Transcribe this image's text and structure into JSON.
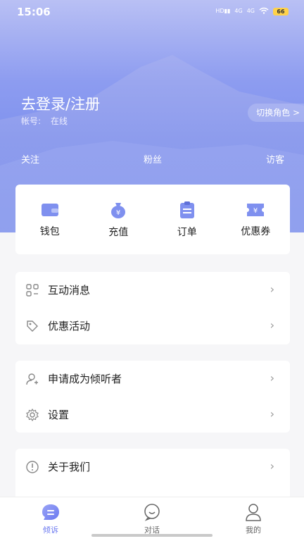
{
  "status": {
    "time": "15:06",
    "battery": "66",
    "network": "4G"
  },
  "profile": {
    "login_text": "去登录/注册",
    "account_label": "帐号:",
    "account_status": "在线",
    "switch_role": "切换角色 >"
  },
  "stats": {
    "follow": "关注",
    "fans": "粉丝",
    "visitors": "访客"
  },
  "quick_actions": [
    {
      "label": "钱包",
      "icon": "wallet-icon"
    },
    {
      "label": "充值",
      "icon": "money-bag-icon"
    },
    {
      "label": "订单",
      "icon": "order-icon"
    },
    {
      "label": "优惠券",
      "icon": "coupon-icon"
    }
  ],
  "menu1": [
    {
      "label": "互动消息",
      "icon": "interaction-icon"
    },
    {
      "label": "优惠活动",
      "icon": "tag-icon"
    }
  ],
  "menu2": [
    {
      "label": "申请成为倾听者",
      "icon": "add-user-icon"
    },
    {
      "label": "设置",
      "icon": "gear-icon"
    }
  ],
  "menu3": [
    {
      "label": "关于我们",
      "icon": "info-icon"
    }
  ],
  "tabs": [
    {
      "label": "倾诉",
      "active": true
    },
    {
      "label": "对话",
      "active": false
    },
    {
      "label": "我的",
      "active": false
    }
  ],
  "colors": {
    "accent": "#6a78f0",
    "icon_blue": "#7f90ef"
  }
}
